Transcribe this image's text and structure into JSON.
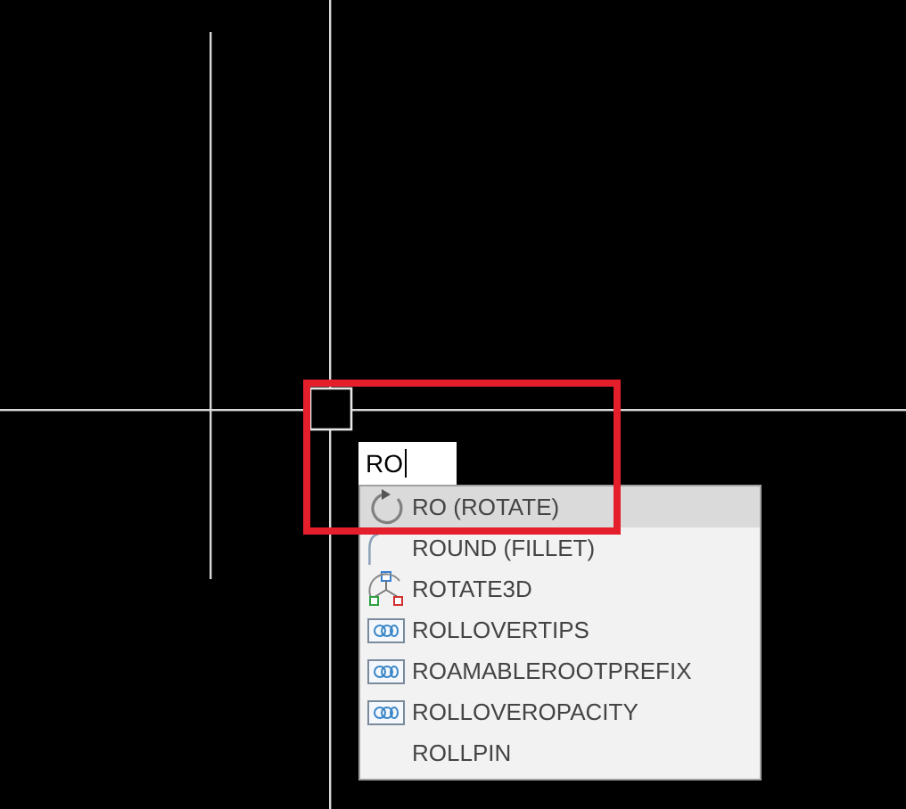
{
  "command_input": {
    "value": "RO"
  },
  "suggestions": [
    {
      "label": "RO (ROTATE)",
      "kind": "rotate",
      "selected": true
    },
    {
      "label": "ROUND (FILLET)",
      "kind": "fillet",
      "selected": false
    },
    {
      "label": "ROTATE3D",
      "kind": "rotate3d",
      "selected": false
    },
    {
      "label": "ROLLOVERTIPS",
      "kind": "variable",
      "selected": false
    },
    {
      "label": "ROAMABLEROOTPREFIX",
      "kind": "variable",
      "selected": false
    },
    {
      "label": "ROLLOVEROPACITY",
      "kind": "variable",
      "selected": false
    },
    {
      "label": "ROLLPIN",
      "kind": "plain",
      "selected": false
    }
  ]
}
